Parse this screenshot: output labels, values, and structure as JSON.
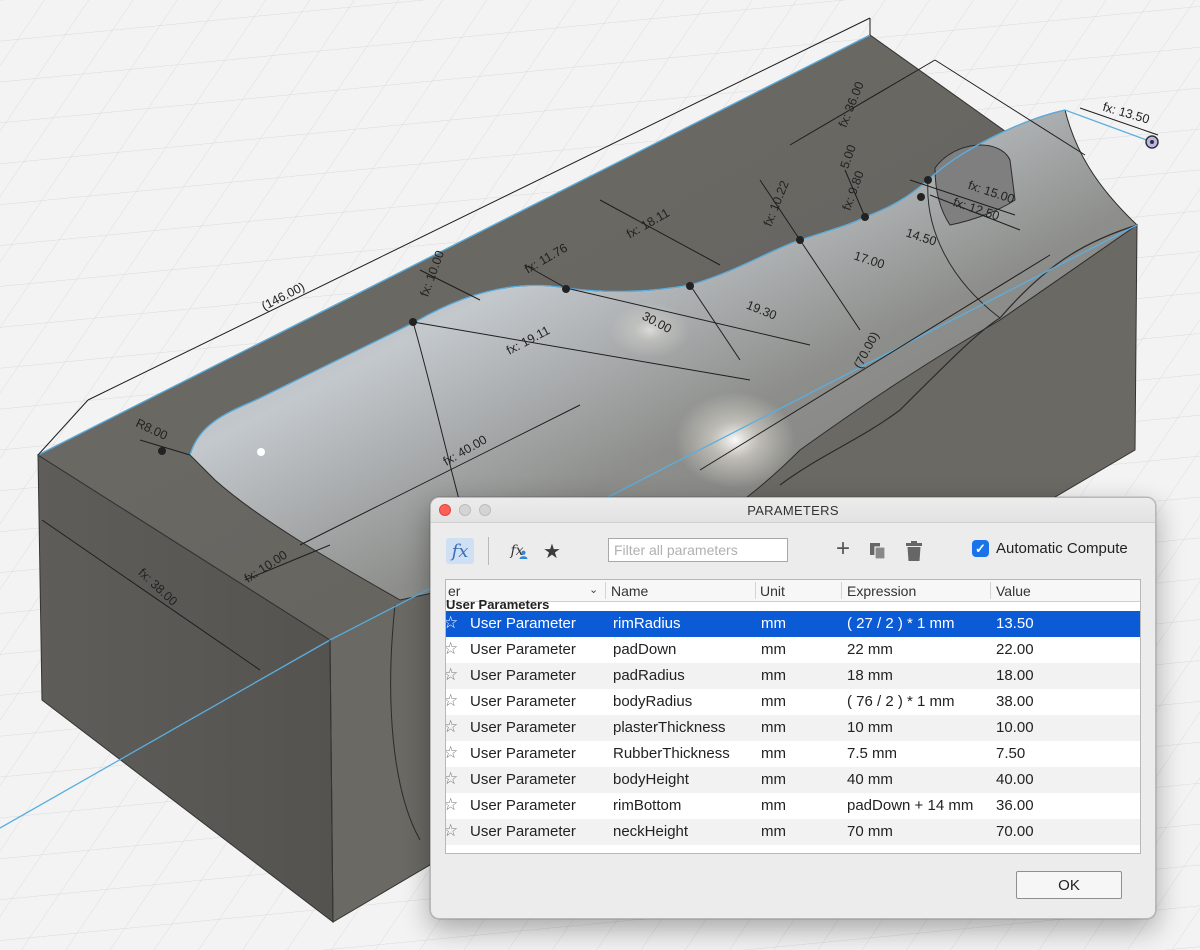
{
  "viewport": {
    "dimensions": [
      {
        "id": "overall-length",
        "text": "(146.00)"
      },
      {
        "id": "rim-radius-dim",
        "text": "fx: 13.50"
      },
      {
        "id": "top-36",
        "text": "fx: 36.00"
      },
      {
        "id": "small-5",
        "text": "5.00"
      },
      {
        "id": "fx-15",
        "text": "fx: 15.00"
      },
      {
        "id": "fx-12-50",
        "text": "fx: 12.50"
      },
      {
        "id": "d-14-50",
        "text": "14.50"
      },
      {
        "id": "fx-9-80",
        "text": "fx: 9.80"
      },
      {
        "id": "fx-10-22",
        "text": "fx: 10.22"
      },
      {
        "id": "d-17",
        "text": "17.00"
      },
      {
        "id": "fx-18-11",
        "text": "fx: 18.11"
      },
      {
        "id": "d-19-30",
        "text": "19.30"
      },
      {
        "id": "fx-11-76",
        "text": "fx: 11.76"
      },
      {
        "id": "d-30",
        "text": "30.00"
      },
      {
        "id": "fx-10-00-top",
        "text": "fx: 10.00"
      },
      {
        "id": "fx-19-11",
        "text": "fx: 19.11"
      },
      {
        "id": "neck-70",
        "text": "(70.00)"
      },
      {
        "id": "r8",
        "text": "R8.00"
      },
      {
        "id": "fx-40",
        "text": "fx: 40.00"
      },
      {
        "id": "fx-10-00-bottom",
        "text": "fx: 10.00"
      },
      {
        "id": "fx-38",
        "text": "fx: 38.00"
      }
    ]
  },
  "dialog": {
    "title": "PARAMETERS",
    "toolbar": {
      "fx_icon": "fx",
      "fx_user_icon": "fx",
      "filter_placeholder": "Filter all parameters",
      "auto_compute_label": "Automatic Compute",
      "auto_compute_checked": true
    },
    "columns": [
      "er",
      "Name",
      "Unit",
      "Expression",
      "Value"
    ],
    "group_label": "User Parameters",
    "rows": [
      {
        "type": "User Parameter",
        "name": "rimRadius",
        "unit": "mm",
        "expression": "( 27 / 2 ) * 1 mm",
        "value": "13.50",
        "selected": true
      },
      {
        "type": "User Parameter",
        "name": "padDown",
        "unit": "mm",
        "expression": "22 mm",
        "value": "22.00"
      },
      {
        "type": "User Parameter",
        "name": "padRadius",
        "unit": "mm",
        "expression": "18 mm",
        "value": "18.00"
      },
      {
        "type": "User Parameter",
        "name": "bodyRadius",
        "unit": "mm",
        "expression": "( 76 / 2 ) * 1 mm",
        "value": "38.00"
      },
      {
        "type": "User Parameter",
        "name": "plasterThickness",
        "unit": "mm",
        "expression": "10 mm",
        "value": "10.00"
      },
      {
        "type": "User Parameter",
        "name": "RubberThickness",
        "unit": "mm",
        "expression": "7.5 mm",
        "value": "7.50"
      },
      {
        "type": "User Parameter",
        "name": "bodyHeight",
        "unit": "mm",
        "expression": "40 mm",
        "value": "40.00"
      },
      {
        "type": "User Parameter",
        "name": "rimBottom",
        "unit": "mm",
        "expression": "padDown + 14 mm",
        "value": "36.00"
      },
      {
        "type": "User Parameter",
        "name": "neckHeight",
        "unit": "mm",
        "expression": "70 mm",
        "value": "70.00"
      }
    ],
    "ok_label": "OK",
    "colors": {
      "selection": "#0b5bd7",
      "checkbox": "#1a73e8",
      "close": "#fe5f57"
    }
  }
}
